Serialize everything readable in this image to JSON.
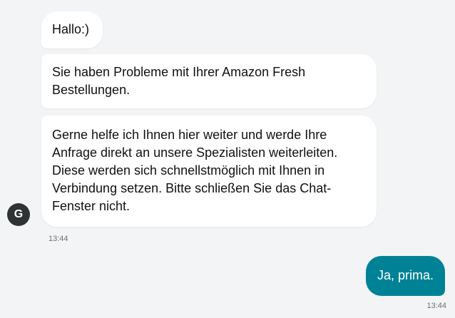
{
  "messages": [
    {
      "text": "Hallo:)"
    },
    {
      "text": "Sie haben Probleme mit Ihrer Amazon Fresh Bestellungen."
    },
    {
      "text": "Gerne helfe ich Ihnen hier weiter und werde Ihre Anfrage direkt an unsere Spezialisten weiterleiten. Diese werden sich schnellstmöglich mit Ihnen in Verbindung setzen. Bitte schließen Sie das Chat-Fenster nicht."
    }
  ],
  "agent": {
    "avatar_letter": "G",
    "timestamp": "13:44"
  },
  "user": {
    "message": "Ja, prima.",
    "timestamp": "13:44"
  },
  "colors": {
    "user_bubble": "#008296",
    "avatar": "#2f3334",
    "background": "#f2f4f5"
  }
}
